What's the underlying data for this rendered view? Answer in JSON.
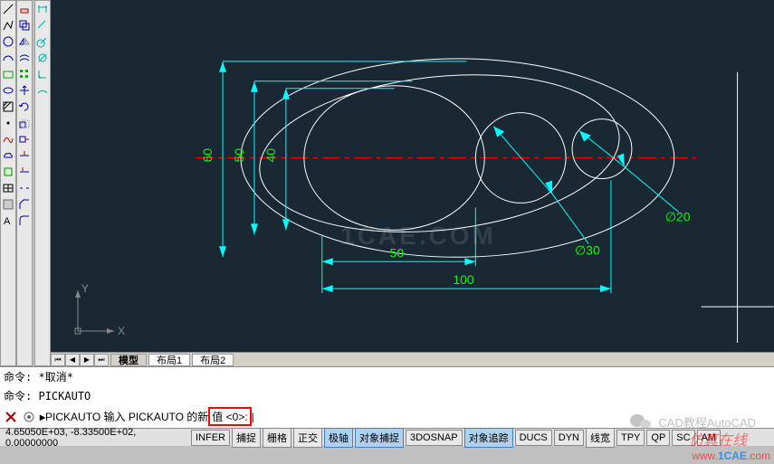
{
  "tabs": {
    "model": "模型",
    "layout1": "布局1",
    "layout2": "布局2"
  },
  "cmd": {
    "line1_prefix": "命令:",
    "line1_text": "*取消*",
    "line2_prefix": "命令:",
    "line2_text": "PICKAUTO",
    "prompt_prefix": "PICKAUTO 输入 PICKAUTO 的新",
    "prompt_boxed": "值 <0>:",
    "caret": "|"
  },
  "status": {
    "coords": "4.65050E+03, -8.33500E+02, 0.00000000",
    "buttons": [
      "INFER",
      "捕捉",
      "栅格",
      "正交",
      "极轴",
      "对象捕捉",
      "3DOSNAP",
      "对象追踪",
      "DUCS",
      "DYN",
      "线宽",
      "TPY",
      "QP",
      "SC",
      "AM"
    ]
  },
  "dims": {
    "d60": "60",
    "d50v": "50",
    "d40": "40",
    "d50h": "50",
    "d100": "100",
    "phi30": "∅30",
    "phi20": "∅20"
  },
  "ucs": {
    "x": "X",
    "y": "Y"
  },
  "watermarks": {
    "center": "1CAE.COM",
    "wechat": "CAD教程AutoCAD",
    "simonline": "仿真在线",
    "url_www": "www.",
    "url_dom": "1CAE",
    "url_com": ".com"
  },
  "tool_icons": {
    "l1": [
      "line-icon",
      "polyline-icon",
      "circle-icon",
      "arc-icon",
      "rect-icon",
      "ellipse-icon",
      "hatch-icon",
      "point-icon",
      "text-icon",
      "region-icon",
      "table-icon",
      "mtext-icon",
      "insert-icon",
      "block-icon",
      "draw-icon"
    ],
    "l2": [
      "erase-icon",
      "copy-icon",
      "mirror-icon",
      "offset-icon",
      "array-icon",
      "move-icon",
      "rotate-icon",
      "scale-icon",
      "stretch-icon",
      "trim-icon",
      "extend-icon",
      "break-icon",
      "join-icon",
      "chamfer-icon",
      "fillet-icon",
      "explode-icon"
    ],
    "l3": [
      "dim-icon",
      "linear-icon",
      "aligned-icon",
      "angular-icon",
      "radius-icon",
      "diameter-icon"
    ]
  }
}
